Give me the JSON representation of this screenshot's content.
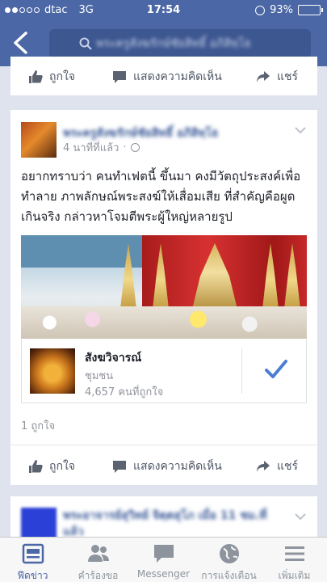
{
  "status_bar": {
    "carrier": "dtac",
    "network": "3G",
    "time": "17:54",
    "battery": "93%",
    "battery_level": 0.93
  },
  "header": {
    "search_text": "พระครูสังฆรักษ์ชัยสิทธิ์ อภิสิทฺโธ"
  },
  "top_actions": {
    "like": "ถูกใจ",
    "comment": "แสดงความคิดเห็น",
    "share": "แชร์"
  },
  "post": {
    "author": "พระครูสังฆรักษ์ชัยสิทธิ์ อภิสิทฺโธ",
    "time": "4 นาทีที่แล้ว",
    "text": "อยากทราบว่า คนทำเฟตนี้ ขึ้นมา คงมีวัตถุประสงค์เพื่อทำลาย ภาพลักษณ์พระสงฆ์ให้เสื่อมเสีย ที่สำคัญคือผูดเกินจริง กล่าวหาโจมตีพระผู้ใหญ่หลายรูป",
    "page": {
      "name": "สังฆวิจารณ์",
      "category": "ชุมชน",
      "likes": "4,657 คนที่ถูกใจ"
    },
    "like_count": "1 ถูกใจ",
    "actions": {
      "like": "ถูกใจ",
      "comment": "แสดงความคิดเห็น",
      "share": "แชร์"
    }
  },
  "next_post": {
    "author": "พระอาจารย์สุวิทย์ จิตฺตสุโภ เมื่อ 11 ชม.ที่แล้ว"
  },
  "tabs": [
    {
      "label": "ฟีดข่าว",
      "icon": "news-feed-icon",
      "active": true
    },
    {
      "label": "คำร้องขอ",
      "icon": "friend-requests-icon",
      "active": false
    },
    {
      "label": "Messenger",
      "icon": "messenger-icon",
      "active": false
    },
    {
      "label": "การแจ้งเตือน",
      "icon": "globe-icon",
      "active": false
    },
    {
      "label": "เพิ่มเติม",
      "icon": "menu-icon",
      "active": false
    }
  ],
  "colors": {
    "brand": "#4b67a6",
    "link": "#3b5998",
    "check": "#4a7ed3",
    "muted": "#90949c"
  }
}
